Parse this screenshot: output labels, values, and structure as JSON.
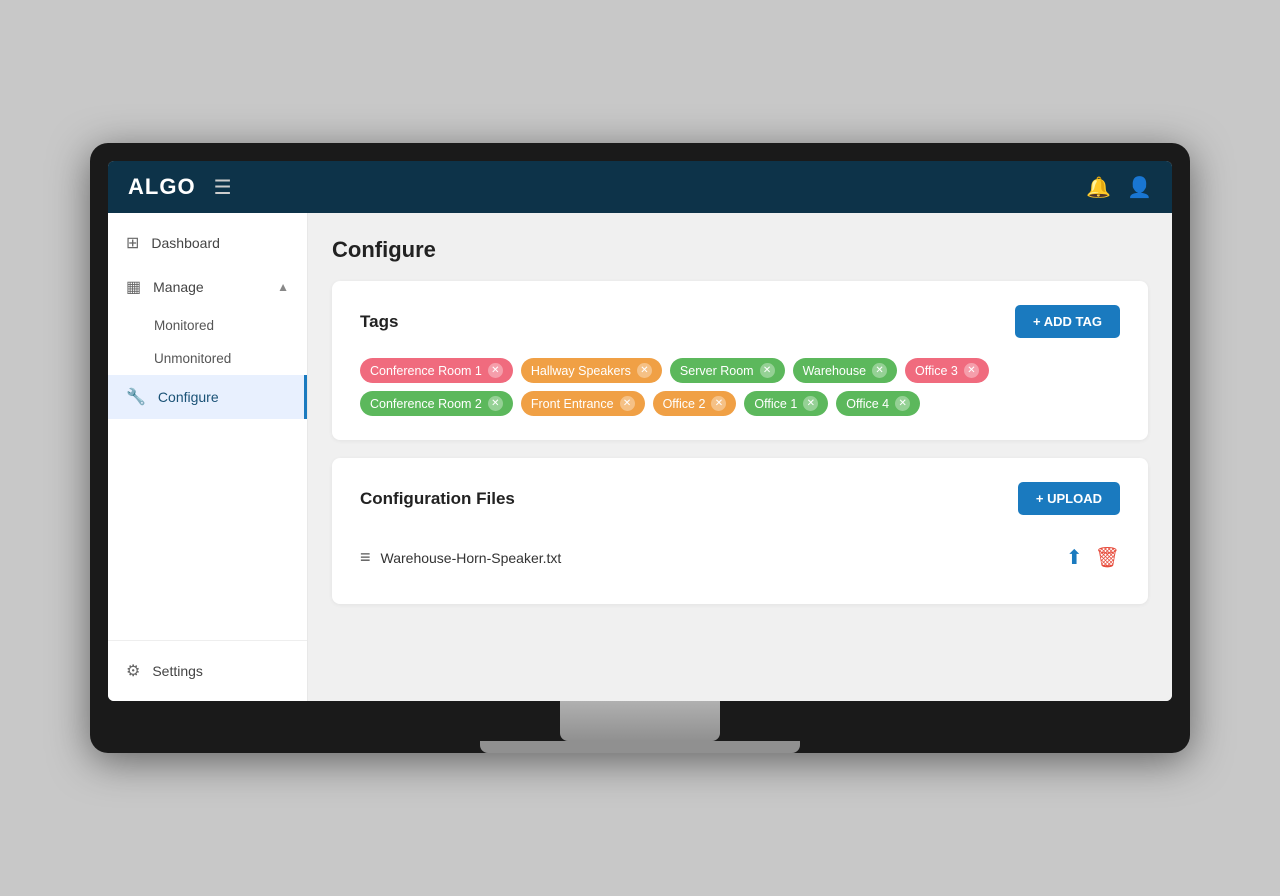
{
  "topnav": {
    "logo": "ALGO",
    "menu_icon": "☰",
    "bell_icon": "🔔",
    "user_icon": "👤"
  },
  "sidebar": {
    "items": [
      {
        "id": "dashboard",
        "label": "Dashboard",
        "icon": "⊞"
      },
      {
        "id": "manage",
        "label": "Manage",
        "icon": "▦",
        "expanded": true,
        "sub": [
          "Monitored",
          "Unmonitored"
        ]
      },
      {
        "id": "configure",
        "label": "Configure",
        "icon": "🔧",
        "active": true
      },
      {
        "id": "settings",
        "label": "Settings",
        "icon": "⚙"
      }
    ]
  },
  "page": {
    "title": "Configure"
  },
  "tags_card": {
    "title": "Tags",
    "add_button": "+ ADD TAG",
    "tags": [
      {
        "label": "Conference Room 1",
        "color": "#f06b7e"
      },
      {
        "label": "Hallway Speakers",
        "color": "#f0a045"
      },
      {
        "label": "Server Room",
        "color": "#5cb85c"
      },
      {
        "label": "Warehouse",
        "color": "#5cb85c"
      },
      {
        "label": "Office 3",
        "color": "#f06b7e"
      },
      {
        "label": "Conference Room 2",
        "color": "#5cb85c"
      },
      {
        "label": "Front Entrance",
        "color": "#f0a045"
      },
      {
        "label": "Office 2",
        "color": "#f0a045"
      },
      {
        "label": "Office 1",
        "color": "#5cb85c"
      },
      {
        "label": "Office 4",
        "color": "#5cb85c"
      }
    ]
  },
  "config_files_card": {
    "title": "Configuration Files",
    "upload_button": "+ UPLOAD",
    "files": [
      {
        "name": "Warehouse-Horn-Speaker.txt"
      }
    ]
  }
}
